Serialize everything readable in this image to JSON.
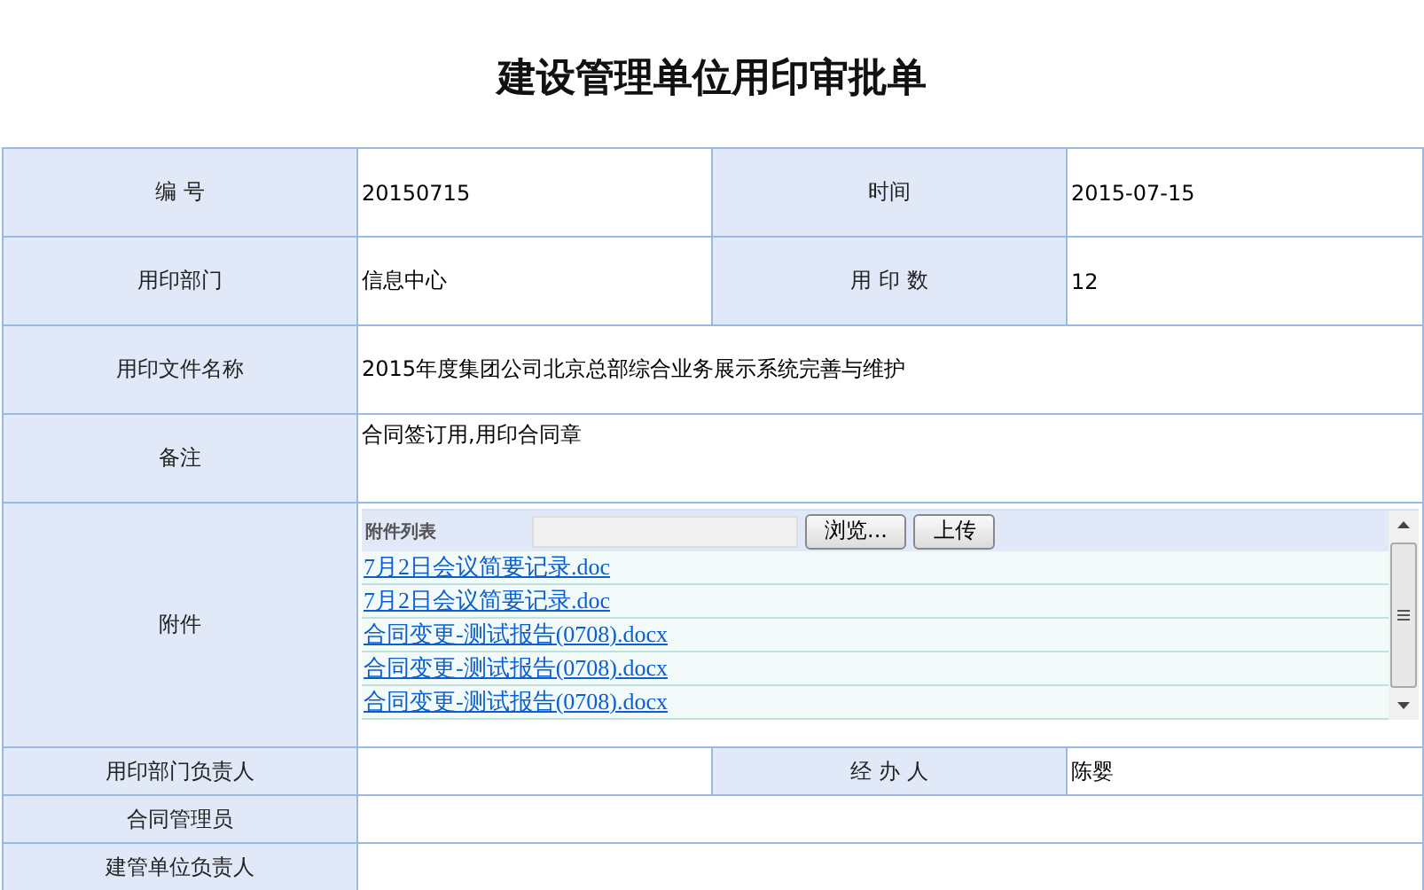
{
  "title": "建设管理单位用印审批单",
  "rows": [
    {
      "kind": "pair",
      "cells": [
        {
          "label": "编 号",
          "value": "20150715"
        },
        {
          "label": "时间",
          "value": "2015-07-15"
        }
      ]
    },
    {
      "kind": "pair",
      "cells": [
        {
          "label": "用印部门",
          "value": "信息中心"
        },
        {
          "label": "用 印 数",
          "value": "12"
        }
      ]
    },
    {
      "kind": "wide",
      "label": "用印文件名称",
      "value": "2015年度集团公司北京总部综合业务展示系统完善与维护"
    },
    {
      "kind": "note",
      "label": "备注",
      "value": "合同签订用,用印合同章"
    },
    {
      "kind": "attachments",
      "label": "附件",
      "header": "附件列表",
      "buttons": [
        "浏览...",
        "上传"
      ],
      "files": [
        "7月2日会议简要记录.doc",
        "7月2日会议简要记录.doc",
        "合同变更-测试报告(0708).docx",
        "合同变更-测试报告(0708).docx",
        "合同变更-测试报告(0708).docx"
      ]
    },
    {
      "kind": "pair",
      "cells": [
        {
          "label": "用印部门负责人"
        },
        {
          "label": "经 办 人",
          "value": "陈婴"
        }
      ]
    },
    {
      "kind": "wide",
      "label": "合同管理员"
    },
    {
      "kind": "wide",
      "label": "建管单位负责人"
    }
  ]
}
